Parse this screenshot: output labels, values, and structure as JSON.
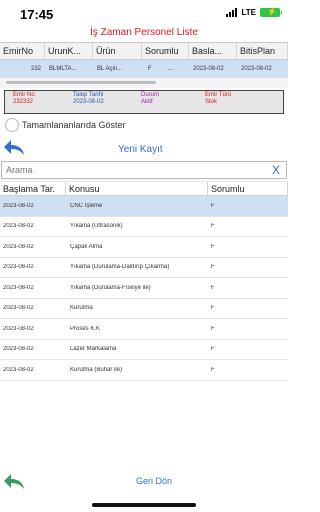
{
  "status_bar": {
    "time": "17:45",
    "network": "LTE"
  },
  "page_title": "İş Zaman Personel Liste",
  "order_table": {
    "columns": [
      "EmirNo",
      "UrunK...",
      "Ürün",
      "Sorumlu",
      "Basla...",
      "BitisPlan"
    ],
    "rows": [
      [
        "232",
        "BLMLTA...",
        "BL Açılı...",
        "F",
        "...",
        "2023-08-02",
        "2023-08-02"
      ]
    ]
  },
  "info": {
    "emir_no_label": "Emir No",
    "emir_no_value": "232332",
    "talep_label": "Talep Tarihi",
    "talep_value": "2023-08-02",
    "durum_label": "Durum",
    "durum_value": "Aktif",
    "tur_label": "Emir Türü",
    "tur_value": "Stok"
  },
  "toggle_label": "Tamamlananlarıda Göster",
  "new_record_label": "Yeni Kayıt",
  "search": {
    "placeholder": "Arama",
    "clear": "X"
  },
  "ops_table": {
    "columns": [
      "Başlama Tar.",
      "Konusu",
      "Sorumlu"
    ],
    "rows": [
      [
        "2023-08-02",
        "CNC İşleme",
        "F"
      ],
      [
        "2023-08-02",
        "Yıkama (Ultrasonik)",
        "F"
      ],
      [
        "2023-08-02",
        "Çapak Alma",
        "F"
      ],
      [
        "2023-08-02",
        "Yıkama (Durulama-Daldırıp Çıkarma)",
        "F"
      ],
      [
        "2023-08-02",
        "Yıkama (Durulama-Fıskiye ile)",
        "F"
      ],
      [
        "2023-08-02",
        "Kurutma",
        "F"
      ],
      [
        "2023-08-02",
        "Proses K.K",
        "F"
      ],
      [
        "2023-08-02",
        "Lazer Markalama",
        "F"
      ],
      [
        "2023-08-02",
        "Kurutma (Buhar ile)",
        "F"
      ]
    ],
    "selected_index": 0
  },
  "footer": {
    "back_label": "Geri Dön"
  },
  "colors": {
    "accent": "#2f6fd6",
    "title_red": "#d9181f",
    "selected_row": "#cfe0f3",
    "back_arrow_top": "#2f6fd6",
    "back_arrow_bottom": "#3a9a6a"
  },
  "icons": {
    "back": "back-arrow-icon",
    "clear": "close-icon",
    "battery": "battery-icon",
    "signal": "signal-icon"
  }
}
